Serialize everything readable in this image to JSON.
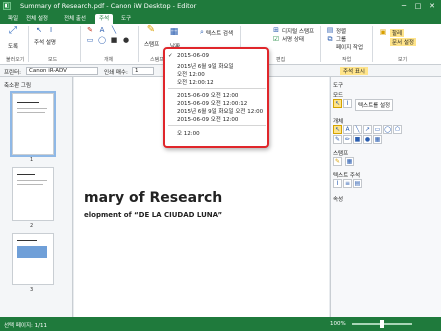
{
  "window": {
    "title": "Summary of Research.pdf - Canon iW Desktop - Editor",
    "minimize": "─",
    "maximize": "□",
    "close": "✕"
  },
  "tabs": [
    "파일",
    "전체 설정",
    "전체 출선",
    "주석",
    "도구"
  ],
  "ribbon": {
    "zoom_label": "도록",
    "fit_label": "페이지 맞춤",
    "annotate_label": "주석 설명",
    "text_label": "텍스트 설정",
    "stamp_label": "스탬프",
    "date_label": "날짜",
    "text_search": "텍스트 검색",
    "digital_stamp": "디지털 스탬프",
    "stamp_status": "서명 상태",
    "arrange": "정렬",
    "group": "그룹",
    "page_action": "페이지 작업",
    "link_label": "링크 설정",
    "group_labels": [
      "불러오기",
      "모드",
      "개체",
      "스탬프",
      "편집",
      "작업",
      "보기"
    ],
    "view_btns": [
      "할레",
      "문서 설정"
    ]
  },
  "toolbar2": {
    "printer_label": "프린터:",
    "printer": "Canon iR-ADV",
    "copies_label": "인쇄 매수:",
    "copies": "1",
    "annotation_display": "주석 표시"
  },
  "leftpane": {
    "title": "축소판 그림",
    "pages": [
      "1",
      "2",
      "3"
    ]
  },
  "document": {
    "title": "mary of Research",
    "subtitle": "elopment of “DE LA CIUDAD LUNA”"
  },
  "popup": {
    "items": [
      "2015-06-09",
      "2015년 6월 9일 화요일",
      "오전 12:00",
      "오전 12:00:12",
      "2015-06-09 오전 12:00",
      "2015-06-09 오전 12:00:12",
      "2015년 6월 9일 화요일 오전 12:00",
      "2015-06-09 오전 12:00",
      "오 12:00"
    ],
    "checkmark": "✓"
  },
  "rightpane": {
    "title": "도구",
    "mode_label": "모드",
    "select_btn": "텍스트를 설정",
    "objects_label": "개체",
    "stamp_label": "스탬프",
    "text_note_label": "텍스트 주석",
    "props_label": "속성"
  },
  "status": {
    "left": "선택 페이지: 1/11",
    "zoom": "100%"
  },
  "colors": {
    "brand": "#1f7a3c",
    "highlight": "#e0262b"
  }
}
